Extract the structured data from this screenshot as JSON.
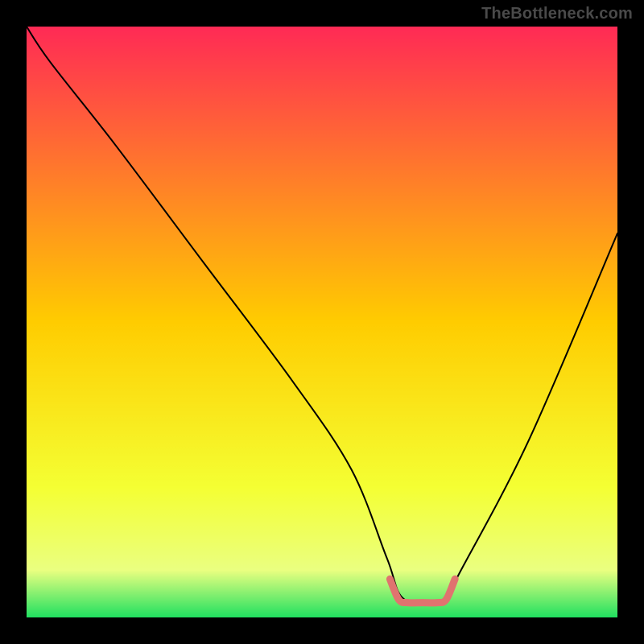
{
  "watermark": "TheBottleneck.com",
  "chart_data": {
    "type": "line",
    "title": "",
    "xlabel": "",
    "ylabel": "",
    "xlim": [
      0,
      100
    ],
    "ylim": [
      0,
      100
    ],
    "grid": false,
    "legend": false,
    "background_gradient": {
      "stops": [
        {
          "pos": 0.0,
          "color": "#ff2a55"
        },
        {
          "pos": 0.5,
          "color": "#ffcc00"
        },
        {
          "pos": 0.78,
          "color": "#f4ff33"
        },
        {
          "pos": 0.92,
          "color": "#eaff80"
        },
        {
          "pos": 1.0,
          "color": "#20e060"
        }
      ]
    },
    "series": [
      {
        "name": "bottleneck-curve",
        "color": "#000000",
        "x": [
          0,
          4,
          15,
          30,
          45,
          55,
          61,
          64,
          71,
          73,
          85,
          100
        ],
        "y": [
          100,
          94,
          80,
          60,
          40,
          25,
          10,
          3,
          3,
          7,
          30,
          65
        ]
      }
    ],
    "highlight_segment": {
      "name": "optimal-range",
      "color": "#e0736f",
      "x": [
        61.5,
        63,
        64.5,
        67,
        69.5,
        71,
        72.5
      ],
      "y": [
        6.5,
        3.0,
        2.5,
        2.5,
        2.5,
        3.0,
        6.5
      ]
    }
  }
}
